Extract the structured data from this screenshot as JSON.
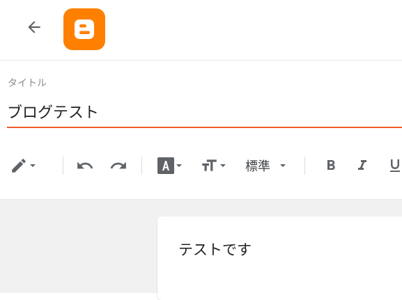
{
  "header": {
    "back_icon": "arrow-left-icon",
    "logo": "blogger-logo",
    "brand_color": "#ff8000"
  },
  "title": {
    "label": "タイトル",
    "value": "ブログテスト",
    "underline_color": "#f25a2c"
  },
  "toolbar": {
    "items": [
      {
        "name": "pen-mode",
        "icon": "pencil-icon",
        "has_dropdown": true
      },
      {
        "name": "undo",
        "icon": "undo-icon"
      },
      {
        "name": "redo",
        "icon": "redo-icon"
      },
      {
        "name": "text-color",
        "icon": "text-color-icon",
        "has_dropdown": true
      },
      {
        "name": "font-size",
        "icon": "text-size-icon",
        "has_dropdown": true
      },
      {
        "name": "format",
        "label": "標準",
        "has_dropdown": true
      },
      {
        "name": "bold",
        "icon": "bold-icon"
      },
      {
        "name": "italic",
        "icon": "italic-icon"
      },
      {
        "name": "underline",
        "icon": "underline-icon"
      }
    ],
    "format_label": "標準"
  },
  "editor": {
    "content": "テストです"
  }
}
